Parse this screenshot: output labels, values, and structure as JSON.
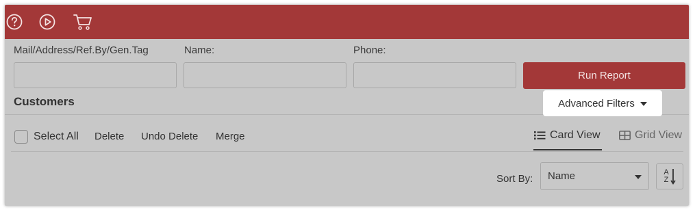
{
  "colors": {
    "brand": "#a33838",
    "background": "#c8c8c8",
    "text": "#333333"
  },
  "topbar": {
    "icons": [
      "help-circle-icon",
      "play-circle-icon",
      "shopping-cart-icon"
    ]
  },
  "search": {
    "fields": [
      {
        "label": "Mail/Address/Ref.By/Gen.Tag",
        "value": "",
        "placeholder": ""
      },
      {
        "label": "Name:",
        "value": "",
        "placeholder": ""
      },
      {
        "label": "Phone:",
        "value": "",
        "placeholder": ""
      }
    ],
    "run_label": "Run Report",
    "advanced_label": "Advanced Filters"
  },
  "section": {
    "title": "Customers"
  },
  "toolbar": {
    "select_all": "Select All",
    "delete": "Delete",
    "undo_delete": "Undo Delete",
    "merge": "Merge"
  },
  "views": {
    "card": "Card View",
    "grid": "Grid View",
    "active": "card"
  },
  "sort": {
    "label": "Sort By:",
    "value": "Name",
    "direction_glyph_top": "A",
    "direction_glyph_bottom": "Z"
  }
}
